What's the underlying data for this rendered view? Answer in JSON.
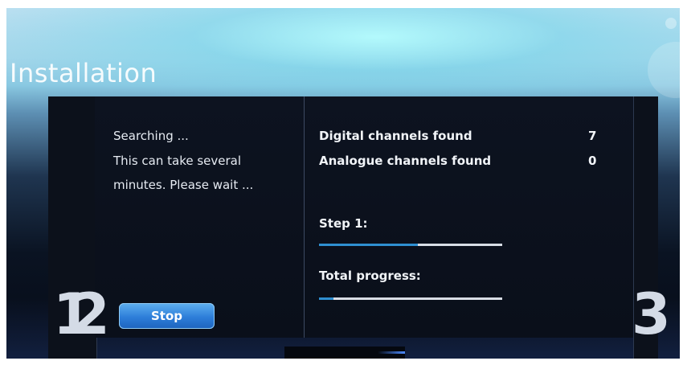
{
  "header": {
    "title": "Installation"
  },
  "steps": {
    "left_numbers": [
      "1",
      "2"
    ],
    "right_number": "3"
  },
  "search": {
    "line1": "Searching ...",
    "line2": "This can take several",
    "line3": "minutes. Please wait ..."
  },
  "results": {
    "digital_label": "Digital channels found",
    "digital_value": "7",
    "analogue_label": "Analogue channels found",
    "analogue_value": "0"
  },
  "progress": {
    "step_label": "Step 1:",
    "step_fraction": 0.54,
    "total_label": "Total progress:",
    "total_fraction": 0.08
  },
  "actions": {
    "stop_label": "Stop"
  },
  "colors": {
    "accent": "#2f8fd1",
    "button": "#2d7ed9",
    "panel": "#0b101c"
  }
}
